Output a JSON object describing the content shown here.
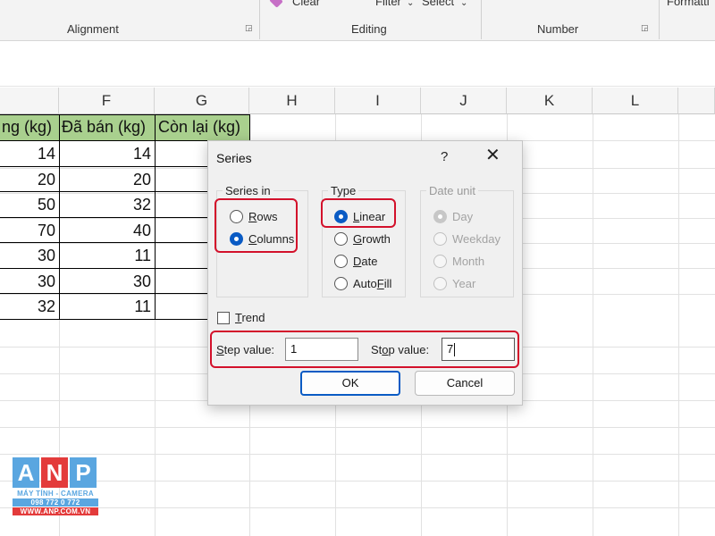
{
  "ribbon": {
    "top_items": [
      "Clear",
      "Filter",
      "Select",
      "Formatti"
    ],
    "groups": [
      "Alignment",
      "Editing",
      "Number"
    ]
  },
  "columns": [
    "F",
    "G",
    "H",
    "I",
    "J",
    "K",
    "L"
  ],
  "table": {
    "headers": [
      "ng (kg)",
      "Đã bán (kg)",
      "Còn lại (kg)"
    ],
    "rows": [
      [
        "14",
        "14"
      ],
      [
        "20",
        "20"
      ],
      [
        "50",
        "32"
      ],
      [
        "70",
        "40"
      ],
      [
        "30",
        "11"
      ],
      [
        "30",
        "30"
      ],
      [
        "32",
        "11"
      ]
    ]
  },
  "dialog": {
    "title": "Series",
    "help": "?",
    "close": "✕",
    "series_in": {
      "legend": "Series in",
      "options": [
        {
          "key": "R",
          "rest": "ows",
          "checked": false
        },
        {
          "key": "C",
          "rest": "olumns",
          "checked": true
        }
      ]
    },
    "type": {
      "legend": "Type",
      "options": [
        {
          "key": "L",
          "rest": "inear",
          "checked": true
        },
        {
          "key": "G",
          "rest": "rowth",
          "checked": false
        },
        {
          "key": "D",
          "rest": "ate",
          "checked": false
        },
        {
          "pre": "Auto",
          "key": "F",
          "rest": "ill",
          "checked": false
        }
      ]
    },
    "date_unit": {
      "legend": "Date unit",
      "options": [
        "Day",
        "Weekday",
        "Month",
        "Year"
      ]
    },
    "trend": {
      "key": "T",
      "rest": "rend",
      "checked": false
    },
    "step": {
      "key": "S",
      "rest": "tep value:",
      "value": "1"
    },
    "stop": {
      "pre": "St",
      "key": "o",
      "rest": "p value:",
      "value": "7"
    },
    "ok_label": "OK",
    "cancel_label": "Cancel"
  },
  "logo": {
    "letters": [
      "A",
      "N",
      "P"
    ],
    "colors": [
      "#5aa6e0",
      "#e33b3b",
      "#5aa6e0"
    ],
    "line1": "MÁY TÍNH - CAMERA",
    "line2": "098 772 0 772",
    "line3": "WWW.ANP.COM.VN"
  }
}
